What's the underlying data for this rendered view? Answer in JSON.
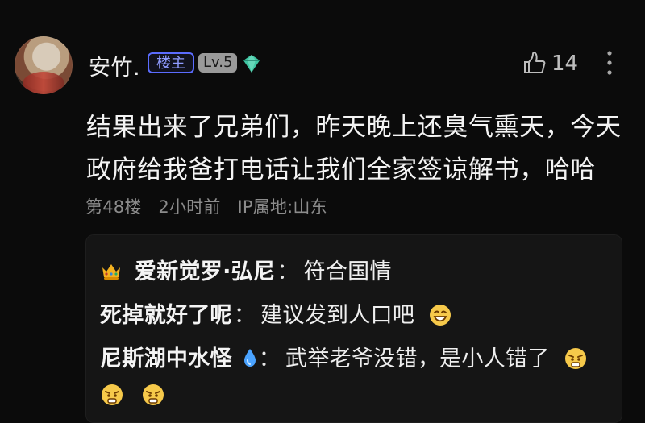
{
  "post": {
    "username": "安竹.",
    "badges": {
      "op": "楼主",
      "level": "Lv.5"
    },
    "icons": {
      "gem": "gem-icon",
      "thumb": "thumb-up-icon",
      "more": "more-vertical-icon"
    },
    "likes": "14",
    "content_lines": [
      "结果出来了兄弟们，昨天晚上还臭气熏天，今天",
      "政府给我爸打电话让我们全家签谅解书，哈哈"
    ],
    "meta": {
      "floor": "第48楼",
      "time": "2小时前",
      "ip": "IP属地:山东"
    }
  },
  "replies": [
    {
      "name": "爱新觉罗·弘尼",
      "separator": "：",
      "text": "符合国情",
      "prefix_icon": "crown-icon"
    },
    {
      "name": "死掉就好了呢",
      "separator": "：",
      "text": "建议发到人口吧",
      "suffix_emoji": [
        "grin-emoji"
      ]
    },
    {
      "name": "尼斯湖中水怪",
      "separator": "：",
      "text": "武举老爷没错，是小人错了",
      "name_icon": "water-drop-icon",
      "suffix_emoji": [
        "angry-face-emoji",
        "angry-face-emoji",
        "angry-face-emoji"
      ]
    }
  ],
  "colors": {
    "background": "#0b0b0b",
    "text": "#f3f3f3",
    "meta": "#8c8c8c",
    "reply_box": "#151515",
    "op_badge": "#5b6cff",
    "gem": "#40c6a3"
  }
}
